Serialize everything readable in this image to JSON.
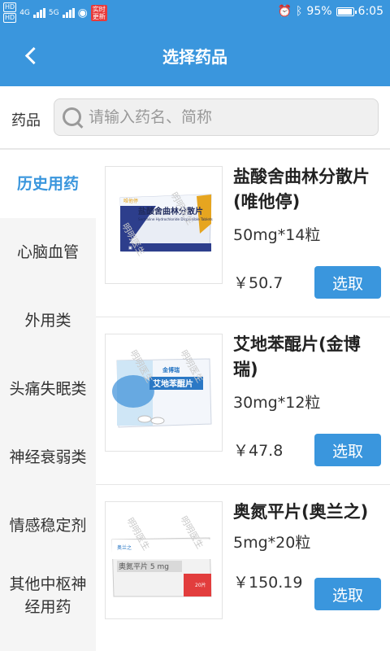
{
  "status_bar": {
    "hd_badges": [
      "HD",
      "HD"
    ],
    "signal_labels": [
      "4G",
      "5G"
    ],
    "notification_badge": "实时\n更新",
    "battery_percent": "95%",
    "battery_level": 0.95,
    "time": "6:05"
  },
  "header": {
    "title": "选择药品"
  },
  "search": {
    "label": "药品",
    "placeholder": "请输入药名、简称",
    "value": ""
  },
  "sidebar": {
    "categories": [
      {
        "label": "历史用药",
        "active": true
      },
      {
        "label": "心脑血管",
        "active": false
      },
      {
        "label": "外用类",
        "active": false
      },
      {
        "label": "头痛失眠类",
        "active": false
      },
      {
        "label": "神经衰弱类",
        "active": false
      },
      {
        "label": "情感稳定剂",
        "active": false
      },
      {
        "label": "其他中枢神经用药",
        "active": false
      }
    ]
  },
  "products": [
    {
      "name": "盐酸舍曲林分散片(唯他停)",
      "spec": "50mg*14粒",
      "price": "￥50.7",
      "button": "选取",
      "box_title": "盐酸舍曲林分散片",
      "box_subtitle": "Sertraline Hydrochloride Dispersible Tablets",
      "box_brand": "唯他停",
      "watermark": "明明医生"
    },
    {
      "name": "艾地苯醌片(金博瑞)",
      "spec": "30mg*12粒",
      "price": "￥47.8",
      "button": "选取",
      "box_title": "艾地苯醌片",
      "box_brand": "金博瑞",
      "watermark": "明明医生"
    },
    {
      "name": "奥氮平片(奥兰之)",
      "spec": "5mg*20粒",
      "price": "￥150.19",
      "button": "选取",
      "box_title": "奥氮平片 5 mg",
      "box_count": "20片",
      "box_brand": "奥兰之",
      "watermark": "明明医生"
    }
  ]
}
